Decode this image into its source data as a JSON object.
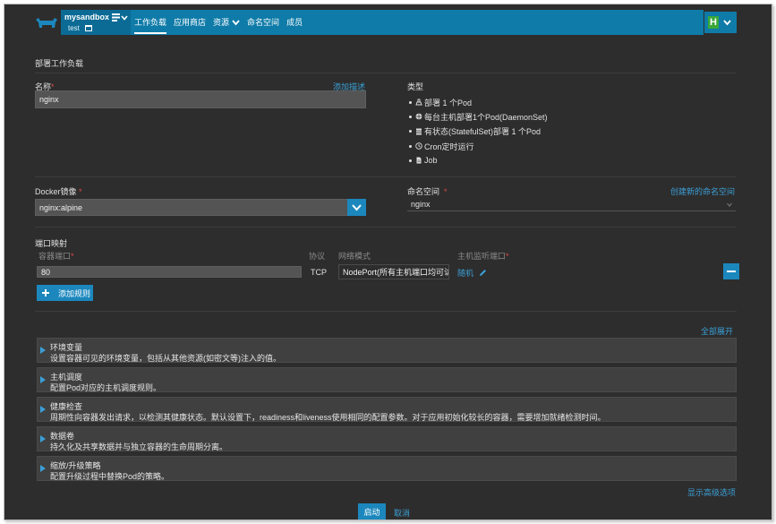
{
  "header": {
    "project_name": "mysandbox",
    "env_name": "test",
    "nav": [
      "工作负载",
      "应用商店",
      "资源",
      "命名空间",
      "成员"
    ],
    "user_badge": "H"
  },
  "form": {
    "section_title": "部署工作负载",
    "name_label": "名称",
    "add_description": "添加描述",
    "name_value": "nginx",
    "type_label": "类型",
    "types": [
      {
        "icon": "scale-icon",
        "label": "部署 1 个Pod"
      },
      {
        "icon": "globe-icon",
        "label": "每台主机部署1个Pod(DaemonSet)"
      },
      {
        "icon": "database-icon",
        "label": "有状态(StatefulSet)部署 1 个Pod"
      },
      {
        "icon": "clock-icon",
        "label": "Cron定时运行"
      },
      {
        "icon": "file-icon",
        "label": "Job"
      }
    ],
    "image_label": "Docker镜像",
    "image_value": "nginx:alpine",
    "namespace_label": "命名空间",
    "create_namespace": "创建新的命名空间",
    "namespace_value": "nginx",
    "ports": {
      "title": "端口映射",
      "col_container_port": "容器端口",
      "col_protocol": "协议",
      "col_network_mode": "网络模式",
      "col_host_port": "主机监听端口",
      "container_port_value": "80",
      "protocol_value": "TCP",
      "network_mode_value": "NodePort(所有主机端口均可访",
      "host_port_value": "随机",
      "add_rule": "添加规则"
    },
    "expand_all": "全部展开",
    "sections": [
      {
        "title": "环境变量",
        "desc": "设置容器可见的环境变量，包括从其他资源(如密文等)注入的值。"
      },
      {
        "title": "主机调度",
        "desc": "配置Pod对应的主机调度规则。"
      },
      {
        "title": "健康检查",
        "desc": "周期性向容器发出请求，以检测其健康状态。默认设置下，readiness和liveness使用相同的配置参数。对于应用初始化较长的容器，需要增加就绪检测时间。"
      },
      {
        "title": "数据卷",
        "desc": "持久化及共享数据并与独立容器的生命周期分离。"
      },
      {
        "title": "缩放/升级策略",
        "desc": "配置升级过程中替换Pod的策略。"
      }
    ],
    "show_advanced": "显示高级选项",
    "launch": "启动",
    "cancel": "取消"
  },
  "colors": {
    "background": "#2d2d2d",
    "header_accent": "#0f7ba8",
    "primary_button": "#1b87bd",
    "link": "#3b9fd6",
    "required": "#e04848",
    "user_badge": "#3aa83a"
  }
}
